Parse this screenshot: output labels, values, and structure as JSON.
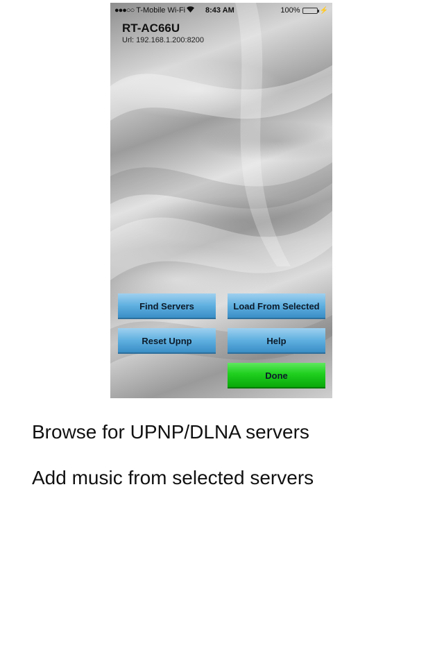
{
  "status_bar": {
    "signal": "●●●○○",
    "carrier": "T-Mobile Wi-Fi",
    "wifi_icon": "wifi-icon",
    "time": "8:43 AM",
    "battery": "100%",
    "battery_level": 1.0
  },
  "header": {
    "title": "RT-AC66U",
    "url": "Url: 192.168.1.200:8200"
  },
  "buttons": {
    "find_servers": "Find Servers",
    "load_from_selected": "Load From Selected",
    "reset_upnp": "Reset Upnp",
    "help": "Help",
    "done": "Done"
  },
  "captions": {
    "line1": "Browse for UPNP/DLNA servers",
    "line2": "Add music from selected servers"
  },
  "colors": {
    "button_blue": "#5fb0e0",
    "button_green": "#1fcf1f",
    "battery_green": "#3fd33f"
  }
}
